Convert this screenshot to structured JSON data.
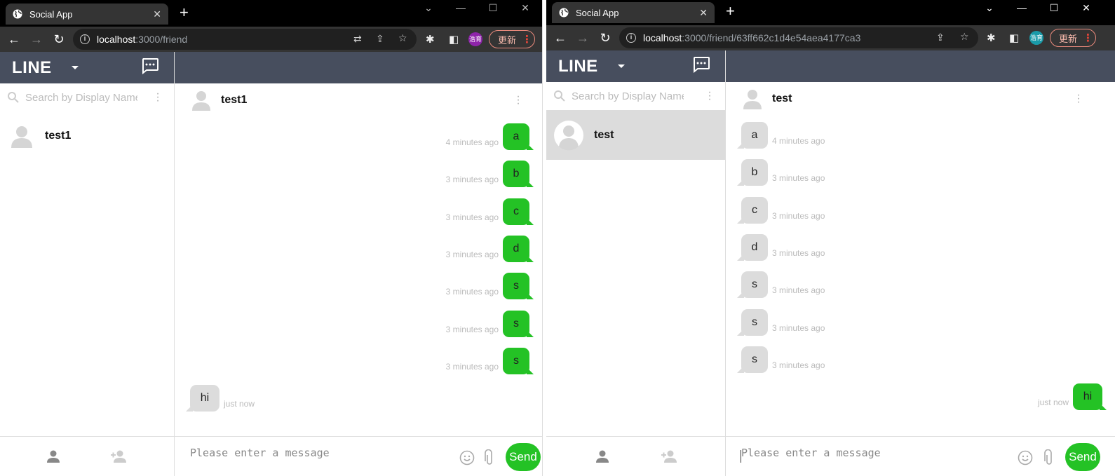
{
  "left_window": {
    "tab_title": "Social App",
    "url_host": "localhost",
    "url_rest": ":3000/friend",
    "profile_initials": "浩育",
    "update_label": "更新",
    "app": {
      "brand": "LINE",
      "search_placeholder": "Search by Display Name",
      "friends": [
        {
          "name": "test1",
          "selected": false
        }
      ],
      "chat_name": "test1",
      "messages": [
        {
          "text": "a",
          "time": "4 minutes ago",
          "direction": "sent"
        },
        {
          "text": "b",
          "time": "3 minutes ago",
          "direction": "sent"
        },
        {
          "text": "c",
          "time": "3 minutes ago",
          "direction": "sent"
        },
        {
          "text": "d",
          "time": "3 minutes ago",
          "direction": "sent"
        },
        {
          "text": "s",
          "time": "3 minutes ago",
          "direction": "sent"
        },
        {
          "text": "s",
          "time": "3 minutes ago",
          "direction": "sent"
        },
        {
          "text": "s",
          "time": "3 minutes ago",
          "direction": "sent"
        },
        {
          "text": "hi",
          "time": "just now",
          "direction": "received"
        }
      ],
      "input_placeholder": "Please enter a message",
      "send_label": "Send"
    }
  },
  "right_window": {
    "tab_title": "Social App",
    "url_host": "localhost",
    "url_rest": ":3000/friend/63ff662c1d4e54aea4177ca3",
    "profile_initials": "浩育",
    "update_label": "更新",
    "app": {
      "brand": "LINE",
      "search_placeholder": "Search by Display Name",
      "friends": [
        {
          "name": "test",
          "selected": true
        }
      ],
      "chat_name": "test",
      "messages": [
        {
          "text": "a",
          "time": "4 minutes ago",
          "direction": "received"
        },
        {
          "text": "b",
          "time": "3 minutes ago",
          "direction": "received"
        },
        {
          "text": "c",
          "time": "3 minutes ago",
          "direction": "received"
        },
        {
          "text": "d",
          "time": "3 minutes ago",
          "direction": "received"
        },
        {
          "text": "s",
          "time": "3 minutes ago",
          "direction": "received"
        },
        {
          "text": "s",
          "time": "3 minutes ago",
          "direction": "received"
        },
        {
          "text": "s",
          "time": "3 minutes ago",
          "direction": "received"
        },
        {
          "text": "hi",
          "time": "just now",
          "direction": "sent"
        }
      ],
      "input_placeholder": "Please enter a message",
      "send_label": "Send"
    }
  },
  "colors": {
    "header_bg": "#474e5e",
    "sent_bubble": "#24c225",
    "received_bubble": "#dcdcdc",
    "selected_friend_bg": "#dcdcdc",
    "profile_left": "#8e24aa",
    "profile_right": "#1a9aa8"
  }
}
